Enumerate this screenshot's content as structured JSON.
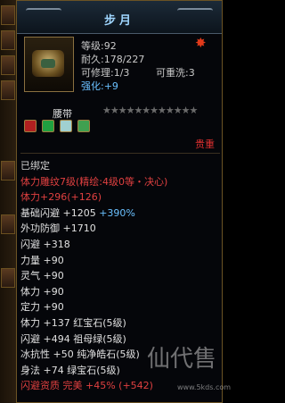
{
  "item": {
    "title": "步月",
    "level": "等级:92",
    "durability": "耐久:178/227",
    "upgrade": "可修理:1/3",
    "reset": "可重洗:3",
    "strengthen_label": "强化:",
    "strengthen_value": "+9",
    "name": "腰带",
    "stars": "★★★★★★★★★★★★",
    "valuable": "贵重"
  },
  "lines": [
    {
      "text": "已绑定",
      "color": "#d0d0d0"
    },
    {
      "text": "体力雕纹7级(精绘:4级0等・决心)",
      "color": "#e04040"
    },
    {
      "text": "体力+296",
      "extra": "(+126)",
      "color": "#e04040",
      "extra_color": "#e04040"
    },
    {
      "text": "基础闪避 +1205",
      "extra": " +390%",
      "color": "#e0e0e0",
      "extra_color": "#6ac0ff"
    },
    {
      "text": "外功防御 +1710",
      "color": "#e0e0e0"
    },
    {
      "text": "闪避 +318",
      "color": "#e0e0e0"
    },
    {
      "text": "力量 +90",
      "color": "#e0e0e0"
    },
    {
      "text": "灵气 +90",
      "color": "#e0e0e0"
    },
    {
      "text": "体力 +90",
      "color": "#e0e0e0"
    },
    {
      "text": "定力 +90",
      "color": "#e0e0e0"
    },
    {
      "text": "体力 +137 红宝石(5级)",
      "color": "#e0e0e0"
    },
    {
      "text": "闪避 +494 祖母绿(5级)",
      "color": "#e0e0e0"
    },
    {
      "text": "冰抗性 +50 纯净皓石(5级)",
      "color": "#e0e0e0"
    },
    {
      "text": "身法 +74 绿宝石(5级)",
      "color": "#e0e0e0"
    },
    {
      "text": "闪避资质 完美 +45%",
      "extra": " (+542)",
      "color": "#e04040",
      "extra_color": "#e04040"
    }
  ],
  "watermark": {
    "big": "仙代售",
    "small": "www.5kds.com"
  }
}
